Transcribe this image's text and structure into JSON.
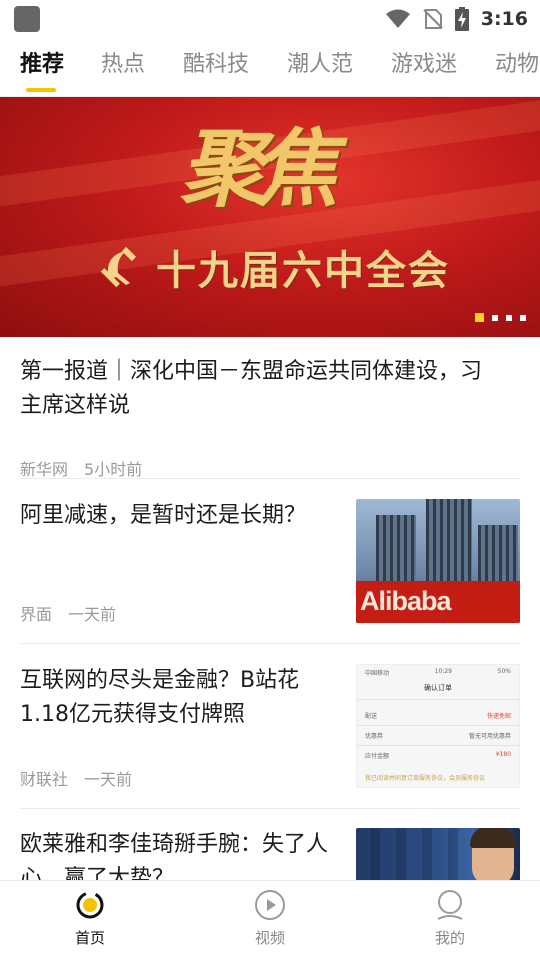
{
  "status_bar": {
    "time": "3:16",
    "icons": [
      "app-icon",
      "wifi-icon",
      "no-sim-icon",
      "battery-charging-icon"
    ]
  },
  "tabs": [
    {
      "label": "推荐",
      "active": true
    },
    {
      "label": "热点",
      "active": false
    },
    {
      "label": "酷科技",
      "active": false
    },
    {
      "label": "潮人范",
      "active": false
    },
    {
      "label": "游戏迷",
      "active": false
    },
    {
      "label": "动物",
      "active": false
    }
  ],
  "banner": {
    "title": "聚焦",
    "subtitle": "十九届六中全会",
    "emblem_icon": "hammer-sickle-icon",
    "page_count": 4,
    "active_page": 1
  },
  "feed": [
    {
      "title": "第一报道｜深化中国－东盟命运共同体建设，习主席这样说",
      "source": "新华网",
      "time": "5小时前",
      "thumbnail": null
    },
    {
      "title": "阿里减速，是暂时还是长期？",
      "source": "界面",
      "time": "一天前",
      "thumbnail": {
        "kind": "photo",
        "sign_text": "Alibaba"
      }
    },
    {
      "title": "互联网的尽头是金融？B站花1.18亿元获得支付牌照",
      "source": "财联社",
      "time": "一天前",
      "thumbnail": {
        "kind": "screenshot",
        "carrier": "中国移动",
        "clock": "10:29",
        "battery": "50%",
        "header": "确认订单",
        "rows": [
          {
            "label": "配送",
            "value": "快递免邮"
          },
          {
            "label": "优惠券",
            "value": "暂无可用优惠券"
          },
          {
            "label": "应付金额",
            "value": "¥180"
          }
        ],
        "agreement": "我已阅读并同意订单服务协议，会员服务协议"
      }
    },
    {
      "title": "欧莱雅和李佳琦掰手腕：失了人心，赢了大势？",
      "source": "",
      "time": "",
      "thumbnail": {
        "kind": "photo"
      }
    }
  ],
  "bottom_nav": [
    {
      "label": "首页",
      "icon": "home-icon",
      "active": true
    },
    {
      "label": "视频",
      "icon": "play-icon",
      "active": false
    },
    {
      "label": "我的",
      "icon": "profile-icon",
      "active": false
    }
  ],
  "colors": {
    "accent": "#f5c400",
    "banner_red": "#c01a1a",
    "banner_gold": "#f2c76a",
    "meta_gray": "#9a9a9a"
  }
}
